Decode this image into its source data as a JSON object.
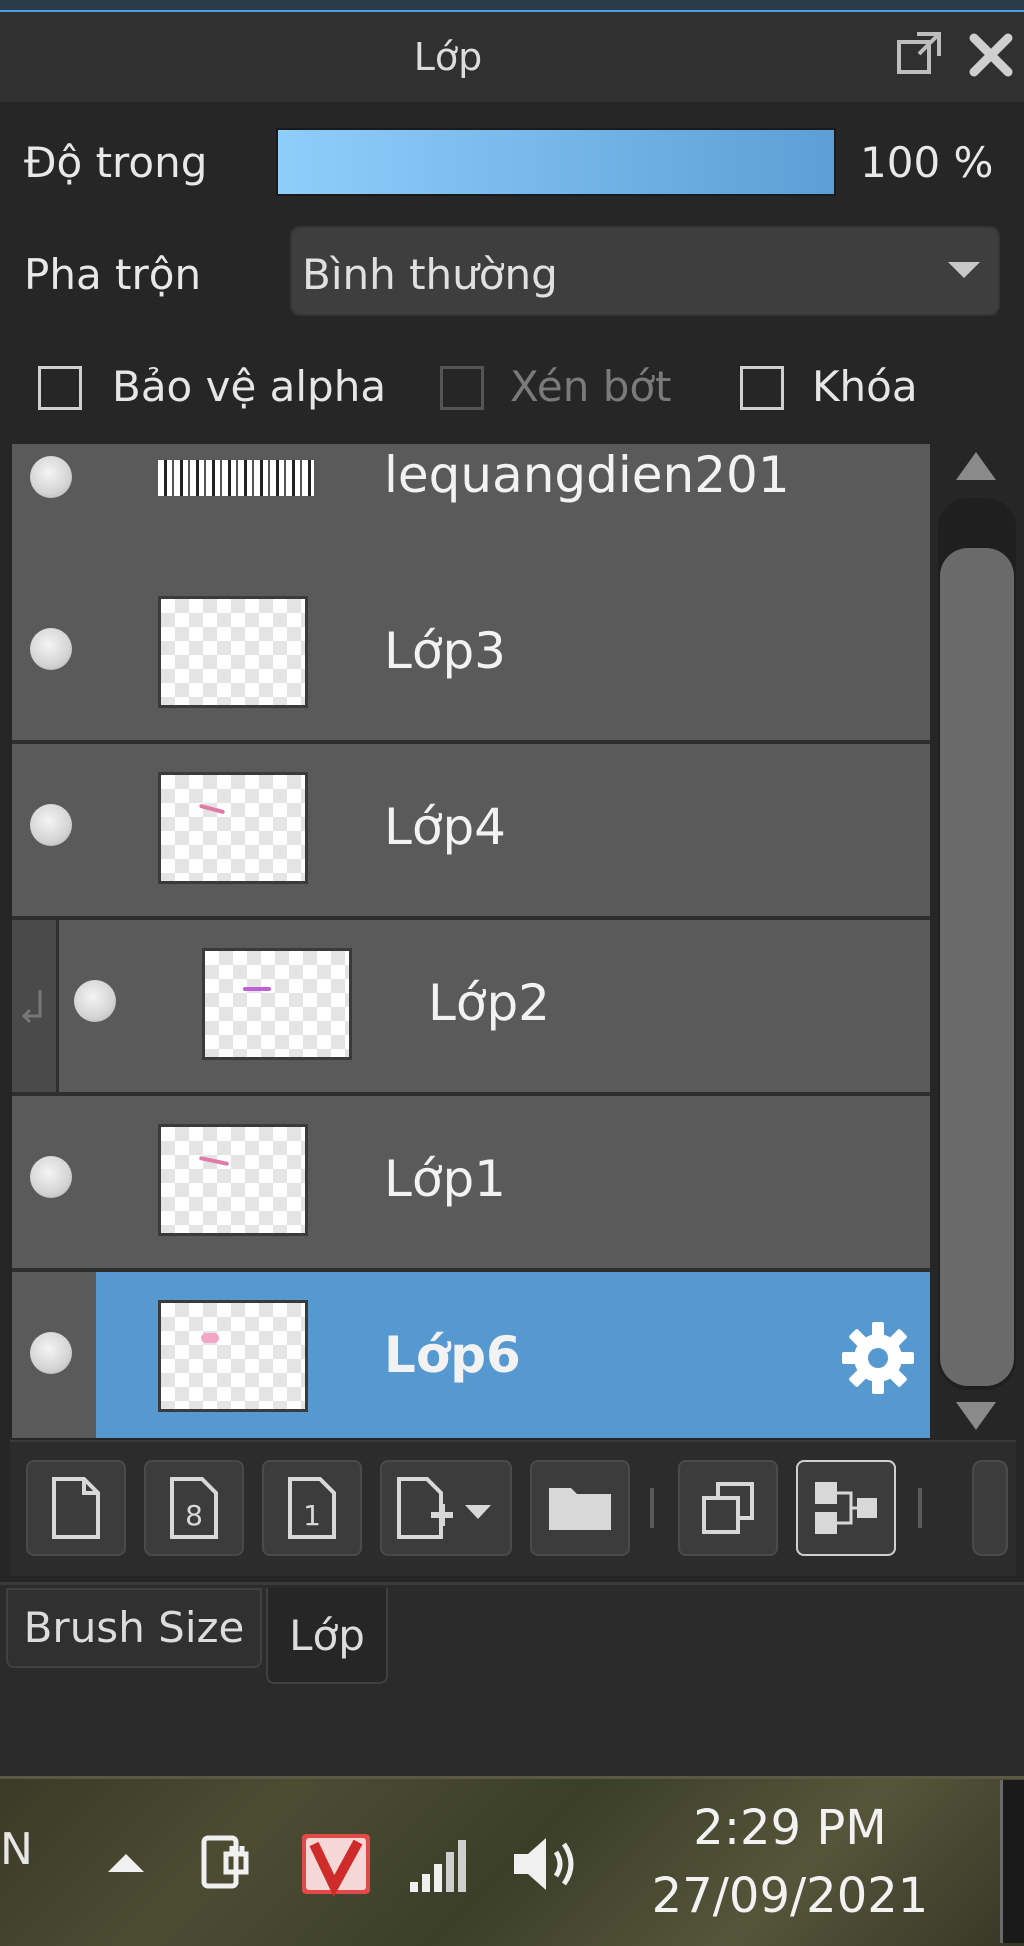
{
  "panel": {
    "title": "Lớp",
    "opacity_label": "Độ trong",
    "opacity_value_text": "100 %",
    "opacity_percent": 100,
    "blend_label": "Pha trộn",
    "blend_value": "Bình thường",
    "checkboxes": {
      "protect_alpha": "Bảo vệ alpha",
      "clipping": "Xén bớt",
      "lock": "Khóa"
    }
  },
  "layers": [
    {
      "name": "lequangdien201"
    },
    {
      "name": "Lớp3"
    },
    {
      "name": "Lớp4"
    },
    {
      "name": "Lớp2",
      "clipped": true
    },
    {
      "name": "Lớp1"
    },
    {
      "name": "Lớp6",
      "selected": true
    }
  ],
  "toolbar": {
    "btn_8": "8",
    "btn_1": "1"
  },
  "tabs": [
    "Brush Size",
    "Lớp"
  ],
  "taskbar": {
    "lang": "N",
    "time": "2:29 PM",
    "date": "27/09/2021"
  },
  "colors": {
    "selection": "#5699d1",
    "opacity_bar_start": "#8fcdfb",
    "opacity_bar_end": "#5c9fd6"
  },
  "icons": [
    "popout-icon",
    "close-icon",
    "gear-icon",
    "new-layer-icon",
    "new-8bit-layer-icon",
    "new-1bit-layer-icon",
    "add-layer-dropdown-icon",
    "folder-icon",
    "duplicate-icon",
    "merge-icon",
    "power-icon",
    "antivirus-icon",
    "signal-icon",
    "volume-icon"
  ]
}
